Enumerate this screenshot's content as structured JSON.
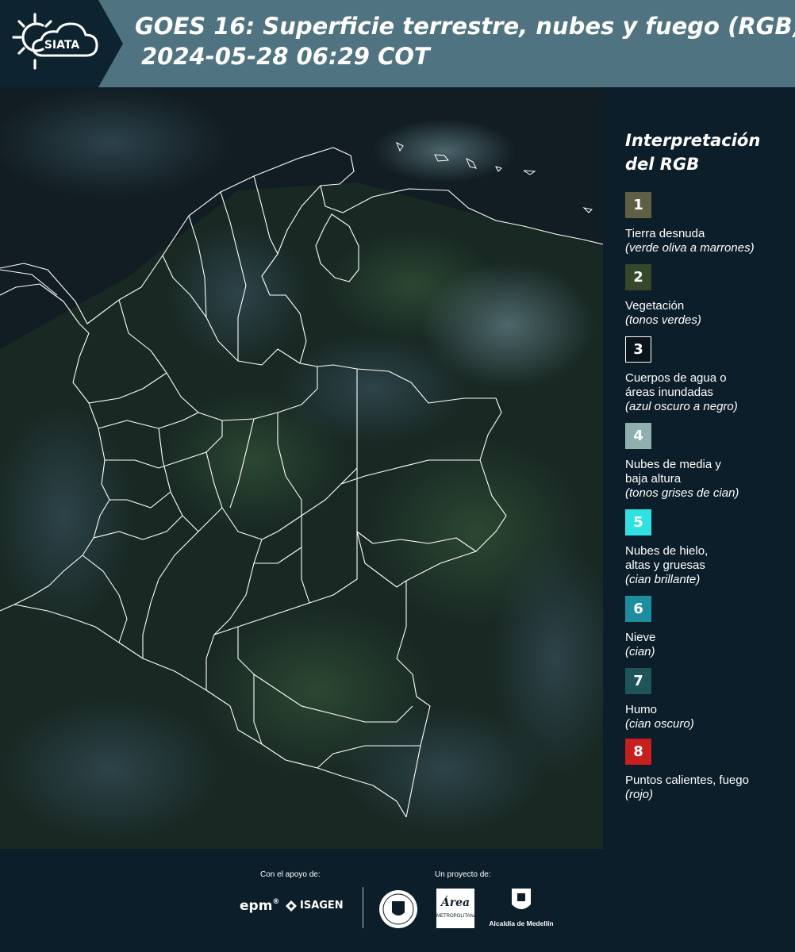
{
  "brand": {
    "logo_text": "SIATA"
  },
  "header": {
    "title_line1": "GOES 16: Superficie terrestre, nubes y fuego (RGB)",
    "title_line2": "2024-05-28 06:29 COT",
    "bg_color": "#4f7380",
    "logo_bg_color": "#0e2330"
  },
  "legend": {
    "title_line1": "Interpretación",
    "title_line2": "del RGB",
    "items": [
      {
        "number": "1",
        "color": "#5f5f45",
        "label_lines": [
          "Tierra desnuda"
        ],
        "note": "(verde oliva a marrones)"
      },
      {
        "number": "2",
        "color": "#35482a",
        "label_lines": [
          "Vegetación"
        ],
        "note": "(tonos verdes)"
      },
      {
        "number": "3",
        "color": "#0a141a",
        "label_lines": [
          "Cuerpos de agua o",
          "áreas inundadas"
        ],
        "note": "(azul oscuro a negro)"
      },
      {
        "number": "4",
        "color": "#8fb0ae",
        "label_lines": [
          "Nubes de media y",
          "baja altura"
        ],
        "note": "(tonos grises de cian)"
      },
      {
        "number": "5",
        "color": "#2ee2e2",
        "label_lines": [
          "Nubes de hielo,",
          "altas y gruesas"
        ],
        "note": "(cian brillante)"
      },
      {
        "number": "6",
        "color": "#1d8ea0",
        "label_lines": [
          "Nieve"
        ],
        "note": "(cian)"
      },
      {
        "number": "7",
        "color": "#1d5558",
        "label_lines": [
          "Humo"
        ],
        "note": "(cian oscuro)"
      },
      {
        "number": "8",
        "color": "#c81e1e",
        "label_lines": [
          "Puntos calientes, fuego"
        ],
        "note": "(rojo)"
      }
    ]
  },
  "footer": {
    "support_label": "Con el apoyo de:",
    "project_label": "Un proyecto de:",
    "sponsor1": "epm",
    "sponsor2": "ISAGEN",
    "org3": "METROPOLITANA",
    "org4": "Alcaldía de Medellín"
  }
}
